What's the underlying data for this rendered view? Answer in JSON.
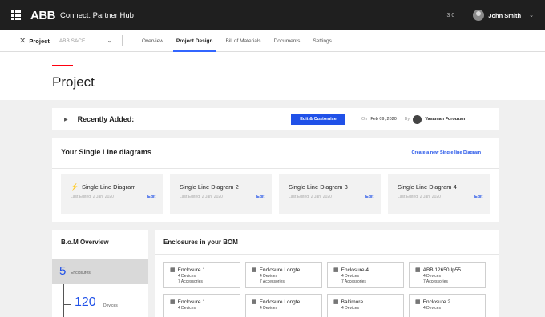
{
  "topbar": {
    "logo": "ABB",
    "app_name": "Connect: Partner Hub",
    "mini": "3 0",
    "user": "John Smith",
    "chevron": "⌄"
  },
  "nav": {
    "project_label": "Project",
    "company_select": "ABB SACE",
    "tabs": [
      {
        "label": "Overview"
      },
      {
        "label": "Project Design"
      },
      {
        "label": "Bill of Materials"
      },
      {
        "label": "Documents"
      },
      {
        "label": "Settings"
      }
    ],
    "active_tab": "Project Design"
  },
  "page": {
    "title": "Project"
  },
  "recent": {
    "label": "Recently Added:",
    "edit_button": "Edit & Customise",
    "on_label": "On",
    "date": "Feb 09, 2020",
    "by_label": "By",
    "author": "Yasaman Forouzan"
  },
  "diagrams": {
    "title": "Your Single Line diagrams",
    "create_link": "Create a new Single line Diagram",
    "items": [
      {
        "name": "Single Line Diagram",
        "edited": "Last Edited: 2 Jan, 2020",
        "edit": "Edit"
      },
      {
        "name": "Single Line Diagram 2",
        "edited": "Last Edited: 2 Jan, 2020",
        "edit": "Edit"
      },
      {
        "name": "Single Line Diagram 3",
        "edited": "Last Edited: 2 Jan, 2020",
        "edit": "Edit"
      },
      {
        "name": "Single Line Diagram 4",
        "edited": "Last Edited: 2 Jan, 2020",
        "edit": "Edit"
      }
    ]
  },
  "bom": {
    "title": "B.o.M Overview",
    "enclosures_count": "5",
    "enclosures_label": "Enclosures",
    "devices_count": "120",
    "devices_label": "Devices"
  },
  "enclosures": {
    "title": "Enclosures in your BOM",
    "items": [
      {
        "name": "Enclosure 1",
        "line1": "4 Devices",
        "line2": "7 Accessories"
      },
      {
        "name": "Enclosure Longte...",
        "line1": "4 Devices",
        "line2": "7 Accessories"
      },
      {
        "name": "Enclosure 4",
        "line1": "4 Devices",
        "line2": "7 Accessories"
      },
      {
        "name": "ABB 12650 Ip55...",
        "line1": "4 Devices",
        "line2": "7 Accessories"
      },
      {
        "name": "Enclosure 1",
        "line1": "4 Devices",
        "line2": ""
      },
      {
        "name": "Enclosure Longte...",
        "line1": "4 Devices",
        "line2": ""
      },
      {
        "name": "Baltimore",
        "line1": "4 Devices",
        "line2": ""
      },
      {
        "name": "Enclosure 2",
        "line1": "4 Devices",
        "line2": ""
      }
    ]
  }
}
